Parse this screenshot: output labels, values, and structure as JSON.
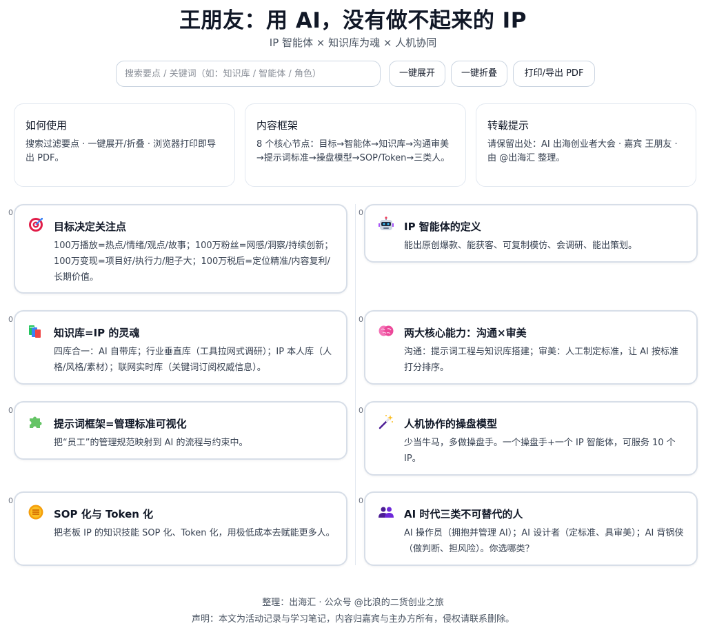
{
  "header": {
    "title": "王朋友：用 AI，没有做不起来的 IP",
    "subtitle": "IP 智能体 × 知识库为魂 × 人机协同"
  },
  "toolbar": {
    "search_placeholder": "搜索要点 / 关键词（如：知识库 / 智能体 / 角色）",
    "expand_label": "一键展开",
    "collapse_label": "一键折叠",
    "print_label": "打印/导出 PDF"
  },
  "info_cards": [
    {
      "title": "如何使用",
      "text": "搜索过滤要点 · 一键展开/折叠 · 浏览器打印即导出 PDF。"
    },
    {
      "title": "内容框架",
      "text": "8 个核心节点：目标→智能体→知识库→沟通审美→提示词标准→操盘模型→SOP/Token→三类人。"
    },
    {
      "title": "转载提示",
      "text": "请保留出处：AI 出海创业者大会 · 嘉宾 王朋友 · 由 @出海汇 整理。"
    }
  ],
  "cards": [
    {
      "num": "0",
      "icon": "target-icon",
      "title": "目标决定关注点",
      "text": "100万播放=热点/情绪/观点/故事；100万粉丝=网感/洞察/持续创新；100万变现=项目好/执行力/胆子大；100万税后=定位精准/内容复利/长期价值。"
    },
    {
      "num": "0",
      "icon": "robot-icon",
      "title": "IP 智能体的定义",
      "text": "能出原创爆款、能获客、可复制模仿、会调研、能出策划。"
    },
    {
      "num": "0",
      "icon": "books-icon",
      "title": "知识库=IP 的灵魂",
      "text": "四库合一：AI 自带库；行业垂直库（工具拉网式调研）；IP 本人库（人格/风格/素材）；联网实时库（关键词订阅权威信息）。"
    },
    {
      "num": "0",
      "icon": "brain-icon",
      "title": "两大核心能力：沟通×审美",
      "text": "沟通：提示词工程与知识库搭建；审美：人工制定标准，让 AI 按标准打分排序。"
    },
    {
      "num": "0",
      "icon": "puzzle-icon",
      "title": "提示词框架=管理标准可视化",
      "text": "把“员工”的管理规范映射到 AI 的流程与约束中。"
    },
    {
      "num": "0",
      "icon": "magic-wand-icon",
      "title": "人机协作的操盘模型",
      "text": "少当牛马，多做操盘手。一个操盘手+一个 IP 智能体，可服务 10 个 IP。"
    },
    {
      "num": "0",
      "icon": "coin-icon",
      "title": "SOP 化与 Token 化",
      "text": "把老板 IP 的知识技能 SOP 化、Token 化，用极低成本去赋能更多人。"
    },
    {
      "num": "0",
      "icon": "people-icon",
      "title": "AI 时代三类不可替代的人",
      "text": "AI 操作员（拥抱并管理 AI）；AI 设计者（定标准、具审美）；AI 背锅侠（做判断、担风险）。你选哪类？"
    }
  ],
  "footer": {
    "credit": "整理：出海汇 · 公众号 @比浪的二货创业之旅",
    "disclaimer": "声明：本文为活动记录与学习笔记，内容归嘉宾与主办方所有，侵权请联系删除。"
  },
  "colors": {
    "card_border": "#d7dee8",
    "info_border": "#e2e8f0",
    "title": "#111827",
    "body_text": "#374151"
  }
}
